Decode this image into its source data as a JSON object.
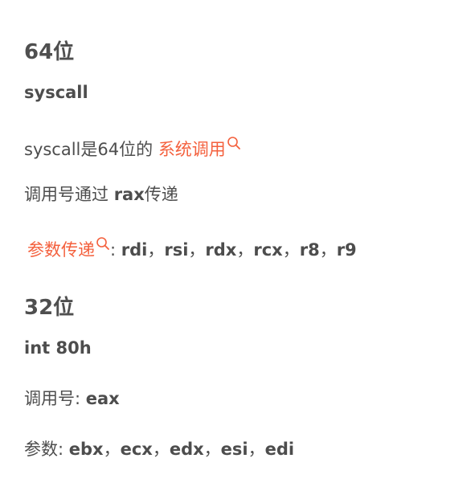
{
  "section_64": {
    "heading": "64位",
    "instr": "syscall",
    "line1_text": "syscall是64位的",
    "line1_link": "系统调用",
    "line2_prefix": "调用号通过",
    "line2_reg": "rax",
    "line2_suffix": "传递",
    "line3_link": "参数传递",
    "line3_colon": ":",
    "line3_regs": [
      "rdi",
      "rsi",
      "rdx",
      "rcx",
      "r8",
      "r9"
    ]
  },
  "section_32": {
    "heading": "32位",
    "instr": "int 80h",
    "line1_label": "调用号:",
    "line1_reg": "eax",
    "line2_label": "参数:",
    "line2_regs": [
      "ebx",
      "ecx",
      "edx",
      "esi",
      "edi"
    ]
  },
  "separator": "，",
  "colors": {
    "text": "#4d4d4d",
    "link": "#f4603d"
  },
  "icons": [
    "search-icon"
  ]
}
